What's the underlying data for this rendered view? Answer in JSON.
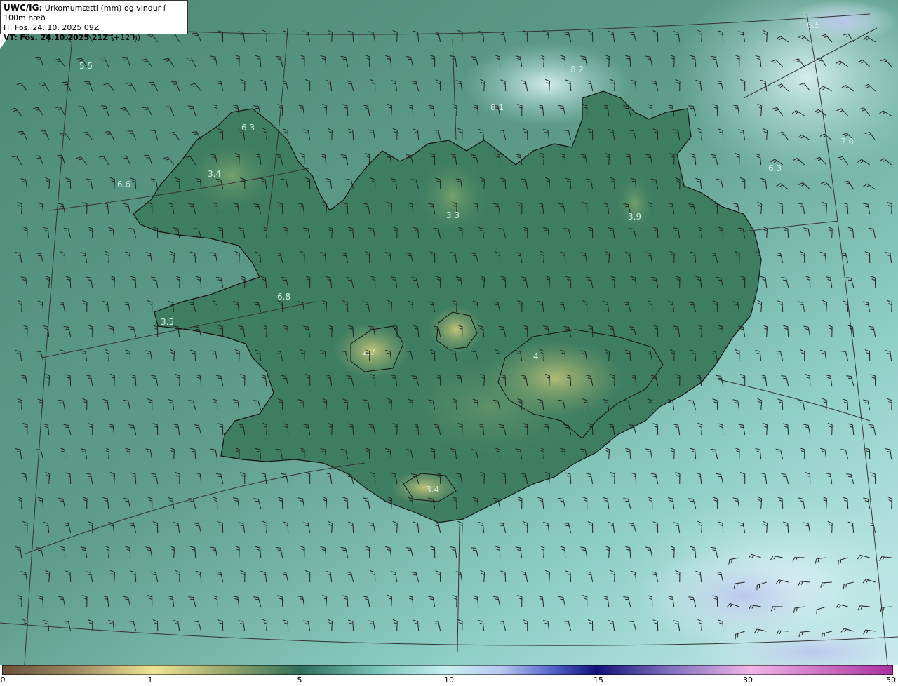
{
  "header": {
    "model": "UWC/IG:",
    "title": "Úrkomumætti (mm) og vindur í 100m hæð",
    "init_prefix": "IT:",
    "init_time": "Fös. 24. 10. 2025 09Z",
    "valid_prefix": "VT:",
    "valid_time": "Fös. 24.10.2025 21Z",
    "lead": "(+12 h)"
  },
  "map": {
    "field_values": [
      "5.5",
      "6.3",
      "3.4",
      "6.6",
      "3.3",
      "3.9",
      "6.3",
      "8.1",
      "8.2",
      "6.8",
      "3.5",
      "2.7",
      "3.4",
      "4",
      "6.5",
      "7.0"
    ],
    "colors": {
      "sea": "#5f9c8a",
      "sea_light": "#a8dcd6",
      "sea_pale": "#cfeef0",
      "sea_blue": "#c4d4f0",
      "land": "#3e7d62",
      "land_high": "#9aaa60",
      "coast": "#111111",
      "barb": "#222222",
      "grid": "#333333"
    }
  },
  "colorbar": {
    "ticks": [
      "0",
      "1",
      "5",
      "10",
      "15",
      "30",
      "50"
    ],
    "colors": [
      "#6b4f3a",
      "#b9a46a",
      "#efe495",
      "#5f9c7e",
      "#2e6d5a",
      "#a6e4df",
      "#dff4fb",
      "#6e7dd8",
      "#10107a",
      "#6a5fb6",
      "#f2b5e6",
      "#a92fa0"
    ]
  }
}
